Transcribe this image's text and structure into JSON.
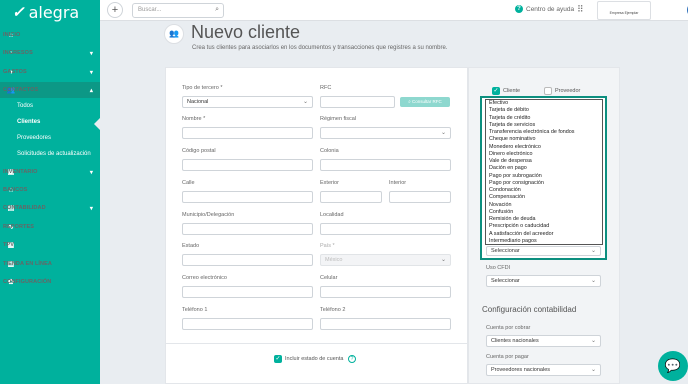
{
  "app": {
    "brand": "alegra",
    "accent": "#00b19d"
  },
  "sidebar": {
    "items": [
      {
        "label": "INICIO",
        "icon": "home-icon",
        "glyph": "⌂",
        "chevron": ""
      },
      {
        "label": "INGRESOS",
        "icon": "income-icon",
        "glyph": "◔",
        "chevron": "▾"
      },
      {
        "label": "GASTOS",
        "icon": "expenses-icon",
        "glyph": "◑",
        "chevron": "▾"
      },
      {
        "label": "CONTACTOS",
        "icon": "contacts-icon",
        "glyph": "👥",
        "chevron": "▴"
      },
      {
        "label": "INVENTARIO",
        "icon": "inventory-icon",
        "glyph": "▣",
        "chevron": "▾"
      },
      {
        "label": "BANCOS",
        "icon": "bank-icon",
        "glyph": "⌂",
        "chevron": ""
      },
      {
        "label": "CONTABILIDAD",
        "icon": "accounting-icon",
        "glyph": "▤",
        "chevron": "▾"
      },
      {
        "label": "REPORTES",
        "icon": "reports-icon",
        "glyph": "∿",
        "chevron": ""
      },
      {
        "label": "TPV",
        "icon": "pos-icon",
        "glyph": "▦",
        "chevron": ""
      },
      {
        "label": "TIENDA EN LÍNEA",
        "icon": "store-icon",
        "glyph": "▥",
        "chevron": ""
      },
      {
        "label": "CONFIGURACIÓN",
        "icon": "settings-icon",
        "glyph": "✿",
        "chevron": ""
      }
    ],
    "subitems": [
      "Todos",
      "Clientes",
      "Proveedores",
      "Solicitudes de actualización"
    ]
  },
  "topbar": {
    "plus": "+",
    "search_placeholder": "Buscar...",
    "help_label": "Centro de ayuda",
    "company_name": "Empresa Ejemplar",
    "avatar_initial": "E"
  },
  "header": {
    "title": "Nuevo cliente",
    "subtitle": "Crea tus clientes para asociarlos en los documentos y transacciones que registres a su nombre."
  },
  "form": {
    "tipo_tercero_label": "Tipo de tercero *",
    "tipo_tercero_value": "Nacional",
    "rfc_label": "RFC",
    "rfc_button": "Consultar RFC",
    "nombre_label": "Nombre *",
    "regimen_label": "Régimen fiscal",
    "cp_label": "Código postal",
    "colonia_label": "Colonia",
    "calle_label": "Calle",
    "exterior_label": "Exterior",
    "interior_label": "Interior",
    "municipio_label": "Municipio/Delegación",
    "localidad_label": "Localidad",
    "estado_label": "Estado",
    "pais_label": "País *",
    "pais_value": "México",
    "correo_label": "Correo electrónico",
    "celular_label": "Celular",
    "tel1_label": "Teléfono 1",
    "tel2_label": "Teléfono 2",
    "estado_cuenta_label": "Incluir estado de cuenta"
  },
  "side": {
    "cliente_label": "Cliente",
    "proveedor_label": "Proveedor",
    "payment_options": [
      "Efectivo",
      "Tarjeta de débito",
      "Tarjeta de crédito",
      "Tarjeta de servicios",
      "Transferencia electrónica de fondos",
      "Cheque nominativo",
      "Monedero electrónico",
      "Dinero electrónico",
      "Vale de despensa",
      "Dación en pago",
      "Pago por subrogación",
      "Pago por consignación",
      "Condonación",
      "Compensación",
      "Novación",
      "Confusión",
      "Remisión de deuda",
      "Prescripción o caducidad",
      "A satisfacción del acreedor",
      "Intermediario pagos"
    ],
    "payment_select_value": "Seleccionar",
    "uso_cfdi_label": "Uso CFDI",
    "uso_cfdi_value": "Seleccionar",
    "config_title": "Configuración contabilidad",
    "cxc_label": "Cuenta por cobrar",
    "cxc_value": "Clientes nacionales",
    "cxp_label": "Cuenta por pagar",
    "cxp_value": "Proveedores nacionales"
  }
}
